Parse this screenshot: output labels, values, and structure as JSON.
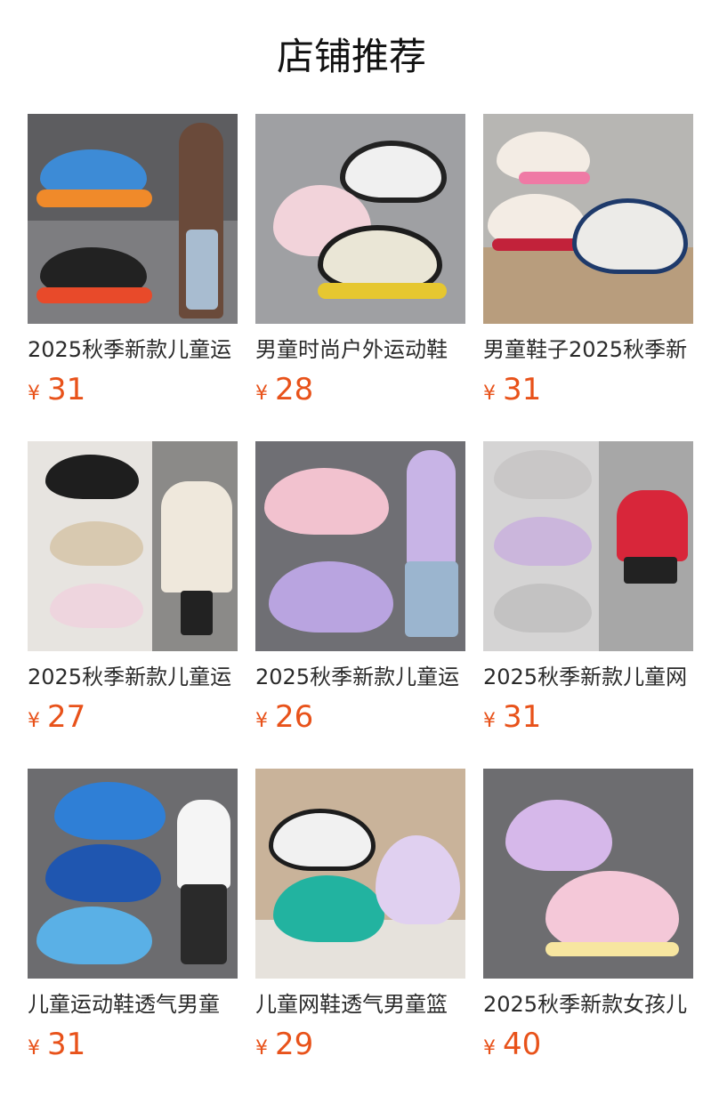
{
  "page_title": "店铺推荐",
  "currency_symbol": "¥",
  "products": [
    {
      "name": "2025秋季新款儿童运",
      "price": "31"
    },
    {
      "name": "男童时尚户外运动鞋",
      "price": "28"
    },
    {
      "name": "男童鞋子2025秋季新",
      "price": "31"
    },
    {
      "name": "2025秋季新款儿童运",
      "price": "27"
    },
    {
      "name": "2025秋季新款儿童运",
      "price": "26"
    },
    {
      "name": "2025秋季新款儿童网",
      "price": "31"
    },
    {
      "name": "儿童运动鞋透气男童",
      "price": "31"
    },
    {
      "name": "儿童网鞋透气男童篮",
      "price": "29"
    },
    {
      "name": "2025秋季新款女孩儿",
      "price": "40"
    }
  ]
}
